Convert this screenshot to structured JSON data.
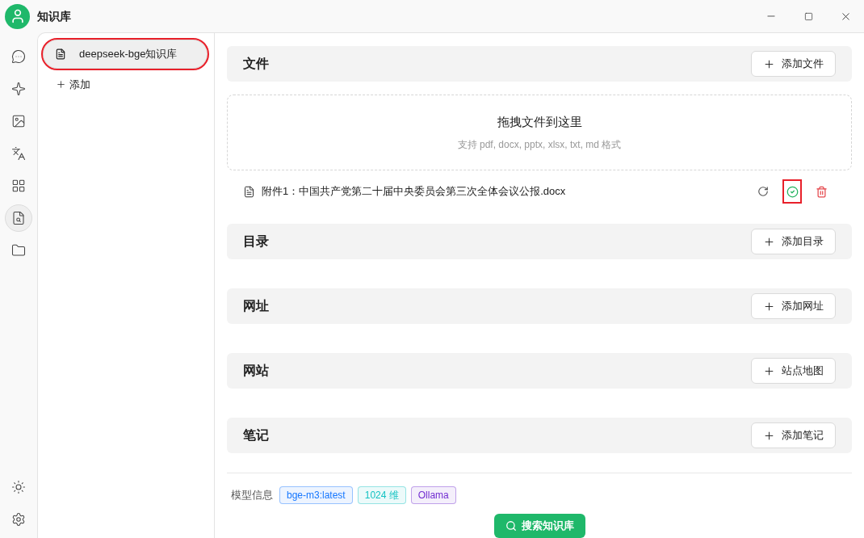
{
  "window": {
    "title": "知识库"
  },
  "nav": [
    {
      "kind": "chat",
      "selected": false
    },
    {
      "kind": "sparkle",
      "selected": false
    },
    {
      "kind": "image",
      "selected": false
    },
    {
      "kind": "translate",
      "selected": false
    },
    {
      "kind": "apps",
      "selected": false
    },
    {
      "kind": "knowledge",
      "selected": true
    },
    {
      "kind": "folder",
      "selected": false
    }
  ],
  "nav_bottom": [
    {
      "kind": "theme"
    },
    {
      "kind": "settings"
    }
  ],
  "knowledge_bases": [
    {
      "name": "deepseek-bge知识库",
      "selected": true,
      "highlighted": true
    }
  ],
  "add_label": "添加",
  "sections": [
    {
      "title": "文件",
      "action": "添加文件",
      "dropzone": {
        "title": "拖拽文件到这里",
        "hint": "支持 pdf, docx, pptx, xlsx, txt, md 格式"
      },
      "files": [
        {
          "name": "附件1：中国共产党第二十届中央委员会第三次全体会议公报.docx",
          "done": true,
          "highlighted": true
        }
      ]
    },
    {
      "title": "目录",
      "action": "添加目录"
    },
    {
      "title": "网址",
      "action": "添加网址"
    },
    {
      "title": "网站",
      "action": "站点地图"
    },
    {
      "title": "笔记",
      "action": "添加笔记"
    }
  ],
  "model_info": {
    "label": "模型信息",
    "tags": [
      {
        "text": "bge-m3:latest",
        "color": "#1677ff"
      },
      {
        "text": "1024 维",
        "color": "#13c2c2"
      },
      {
        "text": "Ollama",
        "color": "#722ed1"
      }
    ]
  },
  "search_button": "搜索知识库"
}
